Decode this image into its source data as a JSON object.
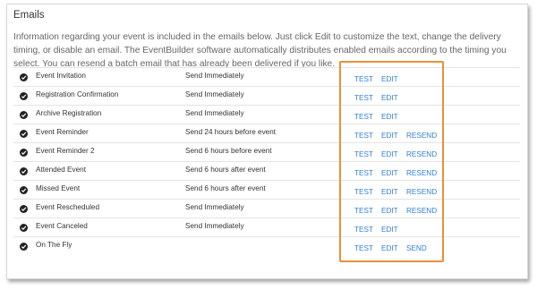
{
  "section": {
    "title": "Emails",
    "description": "Information regarding your event is included in the emails below. Just click Edit to customize the text, change the delivery timing, or disable an email. The EventBuilder software automatically distributes enabled emails according to the timing you select. You can resend a batch email that has already been delivered if you like."
  },
  "emails": [
    {
      "name": "Event Invitation",
      "timing": "Send Immediately",
      "actions": [
        "TEST",
        "EDIT"
      ]
    },
    {
      "name": "Registration Confirmation",
      "timing": "Send Immediately",
      "actions": [
        "TEST",
        "EDIT"
      ]
    },
    {
      "name": "Archive Registration",
      "timing": "Send Immediately",
      "actions": [
        "TEST",
        "EDIT"
      ]
    },
    {
      "name": "Event Reminder",
      "timing": "Send 24 hours before event",
      "actions": [
        "TEST",
        "EDIT",
        "RESEND"
      ]
    },
    {
      "name": "Event Reminder 2",
      "timing": "Send 6 hours before event",
      "actions": [
        "TEST",
        "EDIT",
        "RESEND"
      ]
    },
    {
      "name": "Attended Event",
      "timing": "Send 6 hours after event",
      "actions": [
        "TEST",
        "EDIT",
        "RESEND"
      ]
    },
    {
      "name": "Missed Event",
      "timing": "Send 6 hours after event",
      "actions": [
        "TEST",
        "EDIT",
        "RESEND"
      ]
    },
    {
      "name": "Event Rescheduled",
      "timing": "Send Immediately",
      "actions": [
        "TEST",
        "EDIT",
        "RESEND"
      ]
    },
    {
      "name": "Event Canceled",
      "timing": "Send Immediately",
      "actions": [
        "TEST",
        "EDIT"
      ]
    },
    {
      "name": "On The Fly",
      "timing": "",
      "actions": [
        "TEST",
        "EDIT",
        "SEND"
      ]
    }
  ],
  "colors": {
    "link": "#2f7fd3",
    "highlight": "#e8913a"
  },
  "icons": {
    "enabled": "check-circle-icon"
  }
}
